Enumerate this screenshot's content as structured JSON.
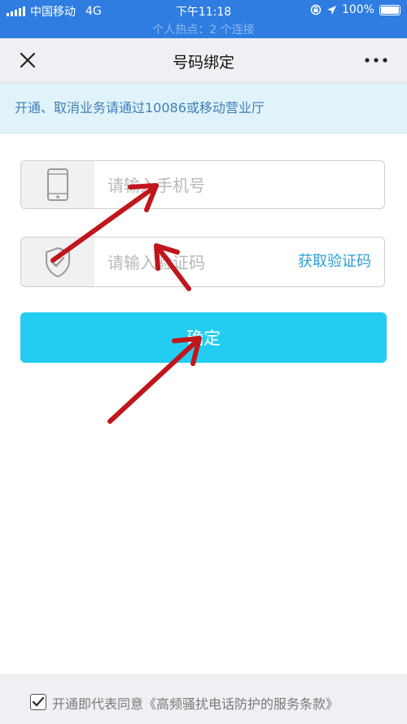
{
  "status_bar": {
    "carrier": "中国移动",
    "network": "4G",
    "time": "下午11:18",
    "battery": "100%",
    "hotspot": "个人热点：2 个连接"
  },
  "nav": {
    "title": "号码绑定"
  },
  "notice": {
    "text": "开通、取消业务请通过10086或移动营业厅"
  },
  "form": {
    "phone_placeholder": "请输入手机号",
    "code_placeholder": "请输入验证码",
    "get_code_label": "获取验证码",
    "confirm_label": "确定"
  },
  "footer": {
    "agree_text": "开通即代表同意《高频骚扰电话防护的服务条款》",
    "checked": true
  },
  "colors": {
    "status_bar": "#2f7de0",
    "accent": "#23cdf2",
    "link": "#2b9fd9",
    "notice_text": "#3e7fb5",
    "annotation_arrow": "#c0161b"
  }
}
